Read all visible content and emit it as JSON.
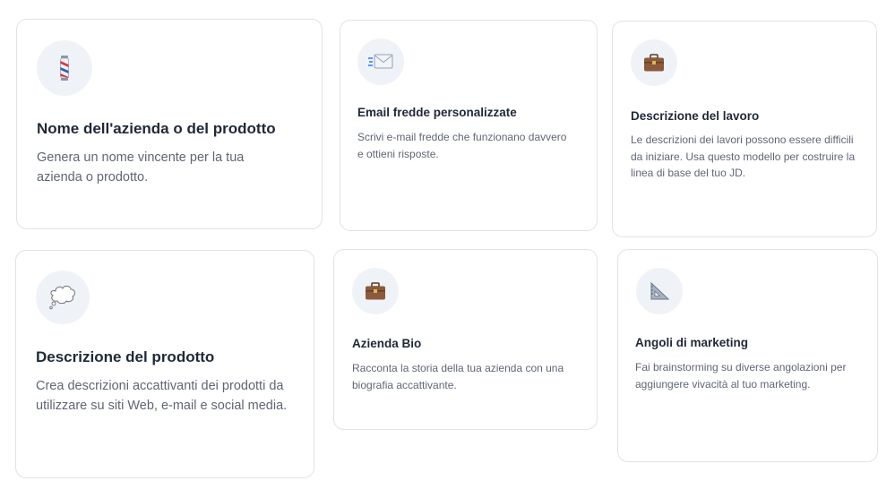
{
  "cards": [
    {
      "icon": "barber-pole-icon",
      "title": "Nome dell'azienda o del prodotto",
      "description": "Genera un nome vincente per la tua azienda o prodotto."
    },
    {
      "icon": "envelope-icon",
      "title": "Email fredde personalizzate",
      "description": "Scrivi e-mail fredde che funzionano davvero e ottieni risposte."
    },
    {
      "icon": "briefcase-icon",
      "title": "Descrizione del lavoro",
      "description": "Le descrizioni dei lavori possono essere difficili da iniziare. Usa questo modello per costruire la linea di base del tuo JD."
    },
    {
      "icon": "thought-bubble-icon",
      "title": "Descrizione del prodotto",
      "description": "Crea descrizioni accattivanti dei prodotti da utilizzare su siti Web, e-mail e social media."
    },
    {
      "icon": "briefcase-icon",
      "title": "Azienda Bio",
      "description": "Racconta la storia della tua azienda con una biografia accattivante."
    },
    {
      "icon": "triangular-ruler-icon",
      "title": "Angoli di marketing",
      "description": "Fai brainstorming su diverse angolazioni per aggiungere vivacità al tuo marketing."
    }
  ]
}
